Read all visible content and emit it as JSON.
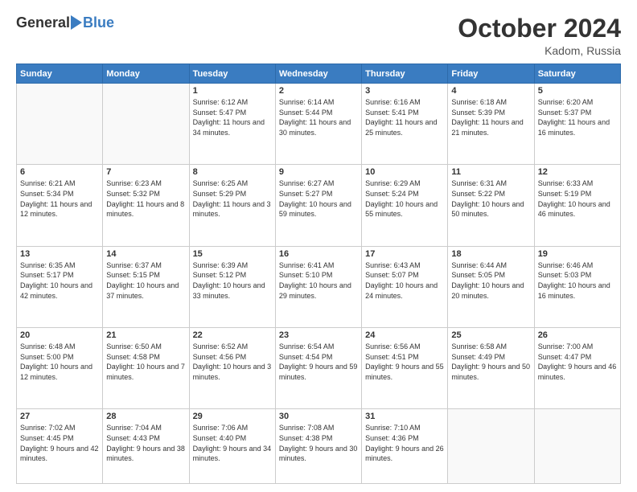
{
  "header": {
    "logo_general": "General",
    "logo_blue": "Blue",
    "month": "October 2024",
    "location": "Kadom, Russia"
  },
  "days_of_week": [
    "Sunday",
    "Monday",
    "Tuesday",
    "Wednesday",
    "Thursday",
    "Friday",
    "Saturday"
  ],
  "weeks": [
    [
      {
        "day": "",
        "detail": ""
      },
      {
        "day": "",
        "detail": ""
      },
      {
        "day": "1",
        "detail": "Sunrise: 6:12 AM\nSunset: 5:47 PM\nDaylight: 11 hours\nand 34 minutes."
      },
      {
        "day": "2",
        "detail": "Sunrise: 6:14 AM\nSunset: 5:44 PM\nDaylight: 11 hours\nand 30 minutes."
      },
      {
        "day": "3",
        "detail": "Sunrise: 6:16 AM\nSunset: 5:41 PM\nDaylight: 11 hours\nand 25 minutes."
      },
      {
        "day": "4",
        "detail": "Sunrise: 6:18 AM\nSunset: 5:39 PM\nDaylight: 11 hours\nand 21 minutes."
      },
      {
        "day": "5",
        "detail": "Sunrise: 6:20 AM\nSunset: 5:37 PM\nDaylight: 11 hours\nand 16 minutes."
      }
    ],
    [
      {
        "day": "6",
        "detail": "Sunrise: 6:21 AM\nSunset: 5:34 PM\nDaylight: 11 hours\nand 12 minutes."
      },
      {
        "day": "7",
        "detail": "Sunrise: 6:23 AM\nSunset: 5:32 PM\nDaylight: 11 hours\nand 8 minutes."
      },
      {
        "day": "8",
        "detail": "Sunrise: 6:25 AM\nSunset: 5:29 PM\nDaylight: 11 hours\nand 3 minutes."
      },
      {
        "day": "9",
        "detail": "Sunrise: 6:27 AM\nSunset: 5:27 PM\nDaylight: 10 hours\nand 59 minutes."
      },
      {
        "day": "10",
        "detail": "Sunrise: 6:29 AM\nSunset: 5:24 PM\nDaylight: 10 hours\nand 55 minutes."
      },
      {
        "day": "11",
        "detail": "Sunrise: 6:31 AM\nSunset: 5:22 PM\nDaylight: 10 hours\nand 50 minutes."
      },
      {
        "day": "12",
        "detail": "Sunrise: 6:33 AM\nSunset: 5:19 PM\nDaylight: 10 hours\nand 46 minutes."
      }
    ],
    [
      {
        "day": "13",
        "detail": "Sunrise: 6:35 AM\nSunset: 5:17 PM\nDaylight: 10 hours\nand 42 minutes."
      },
      {
        "day": "14",
        "detail": "Sunrise: 6:37 AM\nSunset: 5:15 PM\nDaylight: 10 hours\nand 37 minutes."
      },
      {
        "day": "15",
        "detail": "Sunrise: 6:39 AM\nSunset: 5:12 PM\nDaylight: 10 hours\nand 33 minutes."
      },
      {
        "day": "16",
        "detail": "Sunrise: 6:41 AM\nSunset: 5:10 PM\nDaylight: 10 hours\nand 29 minutes."
      },
      {
        "day": "17",
        "detail": "Sunrise: 6:43 AM\nSunset: 5:07 PM\nDaylight: 10 hours\nand 24 minutes."
      },
      {
        "day": "18",
        "detail": "Sunrise: 6:44 AM\nSunset: 5:05 PM\nDaylight: 10 hours\nand 20 minutes."
      },
      {
        "day": "19",
        "detail": "Sunrise: 6:46 AM\nSunset: 5:03 PM\nDaylight: 10 hours\nand 16 minutes."
      }
    ],
    [
      {
        "day": "20",
        "detail": "Sunrise: 6:48 AM\nSunset: 5:00 PM\nDaylight: 10 hours\nand 12 minutes."
      },
      {
        "day": "21",
        "detail": "Sunrise: 6:50 AM\nSunset: 4:58 PM\nDaylight: 10 hours\nand 7 minutes."
      },
      {
        "day": "22",
        "detail": "Sunrise: 6:52 AM\nSunset: 4:56 PM\nDaylight: 10 hours\nand 3 minutes."
      },
      {
        "day": "23",
        "detail": "Sunrise: 6:54 AM\nSunset: 4:54 PM\nDaylight: 9 hours\nand 59 minutes."
      },
      {
        "day": "24",
        "detail": "Sunrise: 6:56 AM\nSunset: 4:51 PM\nDaylight: 9 hours\nand 55 minutes."
      },
      {
        "day": "25",
        "detail": "Sunrise: 6:58 AM\nSunset: 4:49 PM\nDaylight: 9 hours\nand 50 minutes."
      },
      {
        "day": "26",
        "detail": "Sunrise: 7:00 AM\nSunset: 4:47 PM\nDaylight: 9 hours\nand 46 minutes."
      }
    ],
    [
      {
        "day": "27",
        "detail": "Sunrise: 7:02 AM\nSunset: 4:45 PM\nDaylight: 9 hours\nand 42 minutes."
      },
      {
        "day": "28",
        "detail": "Sunrise: 7:04 AM\nSunset: 4:43 PM\nDaylight: 9 hours\nand 38 minutes."
      },
      {
        "day": "29",
        "detail": "Sunrise: 7:06 AM\nSunset: 4:40 PM\nDaylight: 9 hours\nand 34 minutes."
      },
      {
        "day": "30",
        "detail": "Sunrise: 7:08 AM\nSunset: 4:38 PM\nDaylight: 9 hours\nand 30 minutes."
      },
      {
        "day": "31",
        "detail": "Sunrise: 7:10 AM\nSunset: 4:36 PM\nDaylight: 9 hours\nand 26 minutes."
      },
      {
        "day": "",
        "detail": ""
      },
      {
        "day": "",
        "detail": ""
      }
    ]
  ]
}
